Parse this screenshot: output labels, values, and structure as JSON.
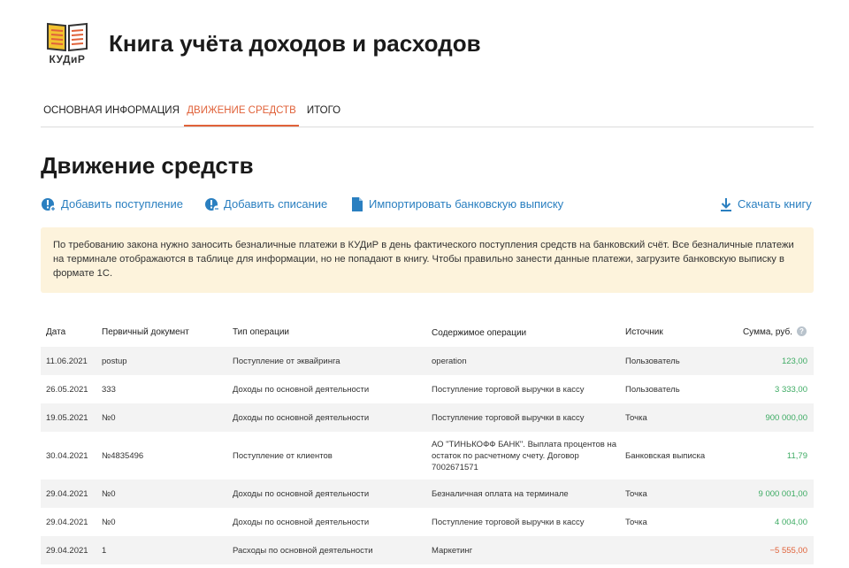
{
  "header": {
    "logo_text": "КУДиР",
    "title": "Книга учёта доходов и расходов"
  },
  "tabs": [
    {
      "label": "Основная информация",
      "active": false
    },
    {
      "label": "Движение средств",
      "active": true
    },
    {
      "label": "Итого",
      "active": false
    }
  ],
  "page_title": "Движение средств",
  "actions": {
    "add_income": "Добавить поступление",
    "add_expense": "Добавить списание",
    "import_statement": "Импортировать банковскую выписку",
    "download_book": "Скачать книгу"
  },
  "notice": "По требованию закона нужно заносить безналичные платежи в КУДиР в день фактического поступления средств на банковский счёт. Все безналичные платежи на терминале отображаются в таблице для информации, но не попадают в книгу. Чтобы правильно занести данные платежи, загрузите банковскую выписку в формате 1С.",
  "table": {
    "columns": {
      "date": "Дата",
      "doc": "Первичный документ",
      "type": "Тип операции",
      "content": "Содержимое операции",
      "source": "Источник",
      "sum": "Сумма, руб."
    },
    "help_icon": "?",
    "rows": [
      {
        "date": "11.06.2021",
        "doc": "postup",
        "type": "Поступление от эквайринга",
        "content": "operation",
        "source": "Пользователь",
        "sum": "123,00"
      },
      {
        "date": "26.05.2021",
        "doc": "333",
        "type": "Доходы по основной деятельности",
        "content": "Поступление торговой выручки в кассу",
        "source": "Пользователь",
        "sum": "3 333,00"
      },
      {
        "date": "19.05.2021",
        "doc": "№0",
        "type": "Доходы по основной деятельности",
        "content": "Поступление торговой выручки в кассу",
        "source": "Точка",
        "sum": "900 000,00"
      },
      {
        "date": "30.04.2021",
        "doc": "№4835496",
        "type": "Поступление от клиентов",
        "content": "АО \"ТИНЬКОФФ БАНК\". Выплата процентов на остаток по расчетному счету. Договор 7002671571",
        "source": "Банковская выписка",
        "sum": "11,79"
      },
      {
        "date": "29.04.2021",
        "doc": "№0",
        "type": "Доходы по основной деятельности",
        "content": "Безналичная оплата на терминале",
        "source": "Точка",
        "sum": "9 000 001,00"
      },
      {
        "date": "29.04.2021",
        "doc": "№0",
        "type": "Доходы по основной деятельности",
        "content": "Поступление торговой выручки в кассу",
        "source": "Точка",
        "sum": "4 004,00"
      },
      {
        "date": "29.04.2021",
        "doc": "1",
        "type": "Расходы по основной деятельности",
        "content": "Маркетинг",
        "source": "",
        "sum": "−5 555,00"
      }
    ]
  },
  "colors": {
    "accent": "#e0623a",
    "link": "#2a7fc0",
    "positive": "#3dab63",
    "negative": "#e0623a",
    "notice_bg": "#fdf3dc"
  }
}
